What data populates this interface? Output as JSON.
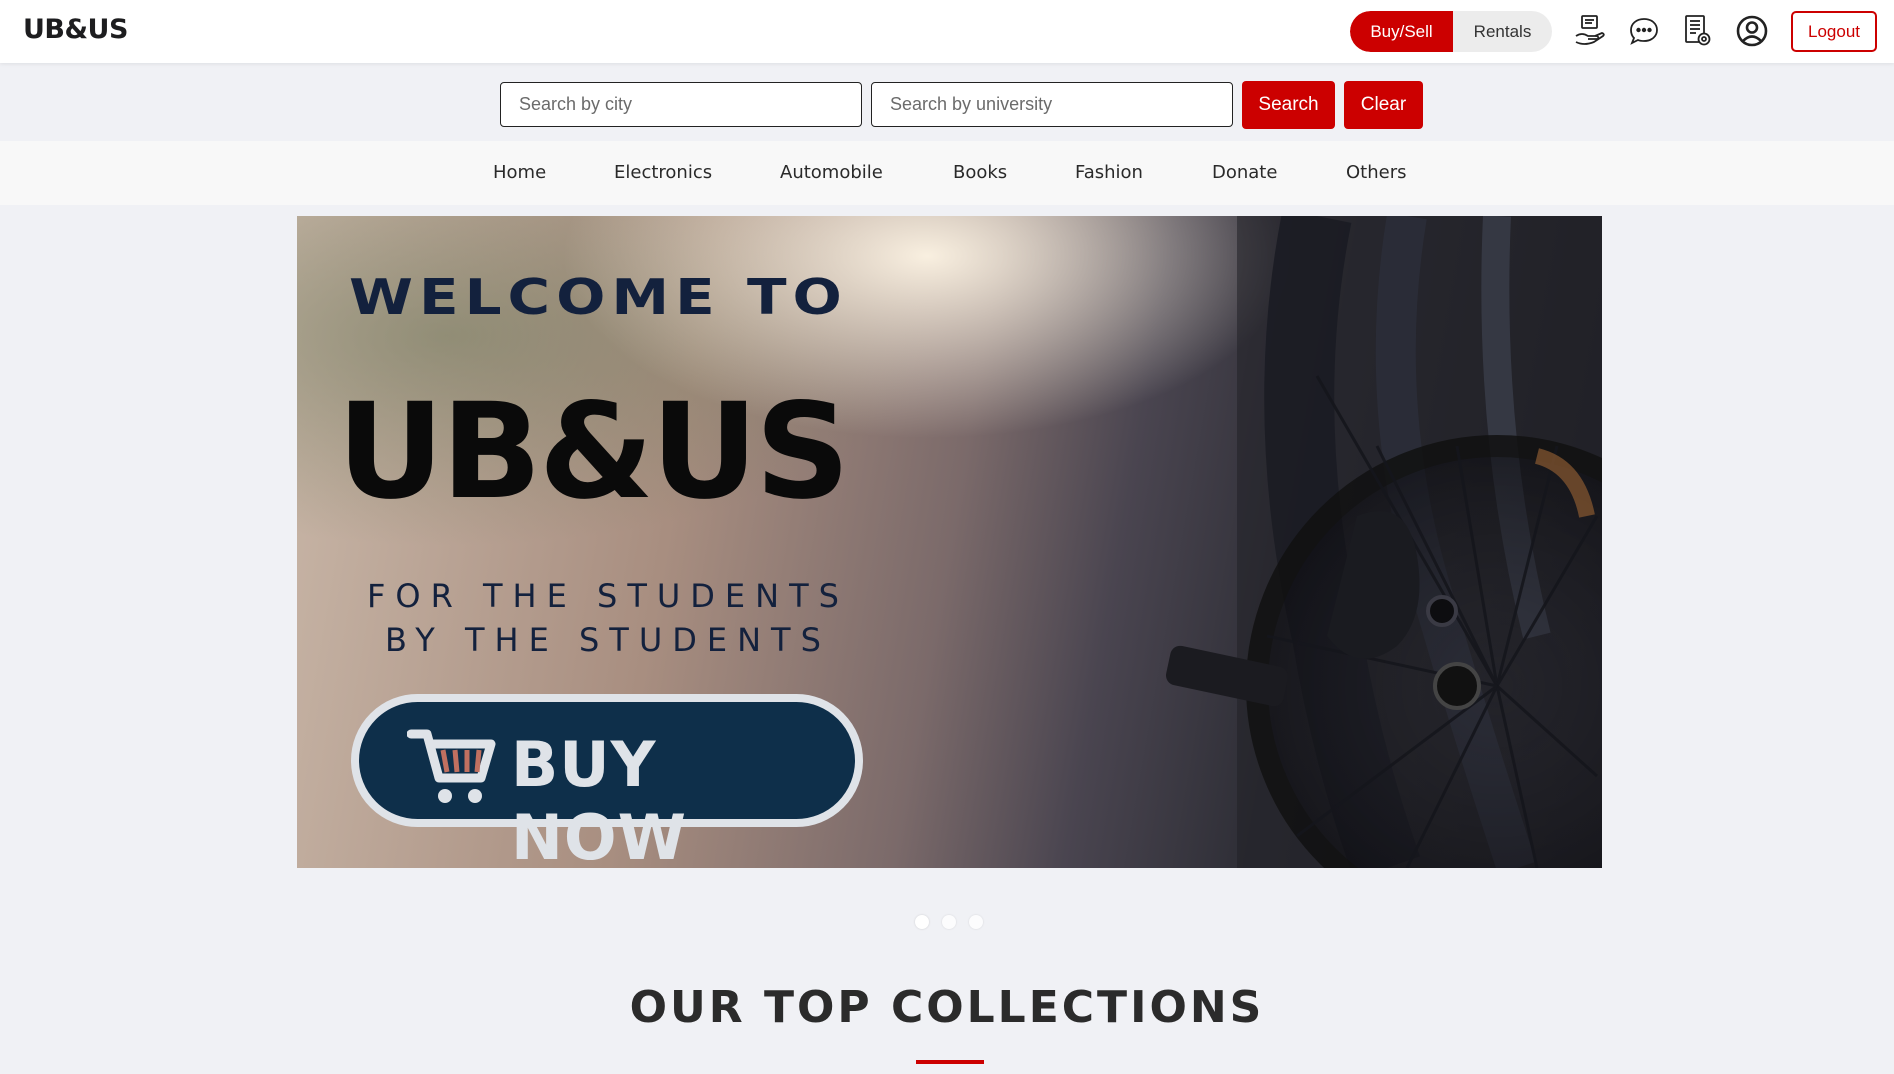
{
  "header": {
    "brand": "UB&US",
    "mode_toggle": {
      "active": "Buy/Sell",
      "inactive": "Rentals"
    },
    "icons": [
      "sell-item-icon",
      "chat-icon",
      "orders-icon",
      "profile-icon"
    ],
    "logout_label": "Logout"
  },
  "search": {
    "city_placeholder": "Search by city",
    "university_placeholder": "Search by university",
    "search_label": "Search",
    "clear_label": "Clear"
  },
  "categories": [
    "Home",
    "Electronics",
    "Automobile",
    "Books",
    "Fashion",
    "Donate",
    "Others"
  ],
  "hero": {
    "welcome": "WELCOME TO",
    "brand": "UB&US",
    "tagline_line1": "FOR THE STUDENTS",
    "tagline_line2": "BY THE STUDENTS",
    "cta": "BUY NOW",
    "slide_count": 3,
    "active_slide": 1
  },
  "section": {
    "title": "OUR TOP COLLECTIONS"
  },
  "colors": {
    "accent": "#cc0000",
    "cta_bg": "#0e2f4a",
    "page_bg": "#f0f1f5"
  }
}
